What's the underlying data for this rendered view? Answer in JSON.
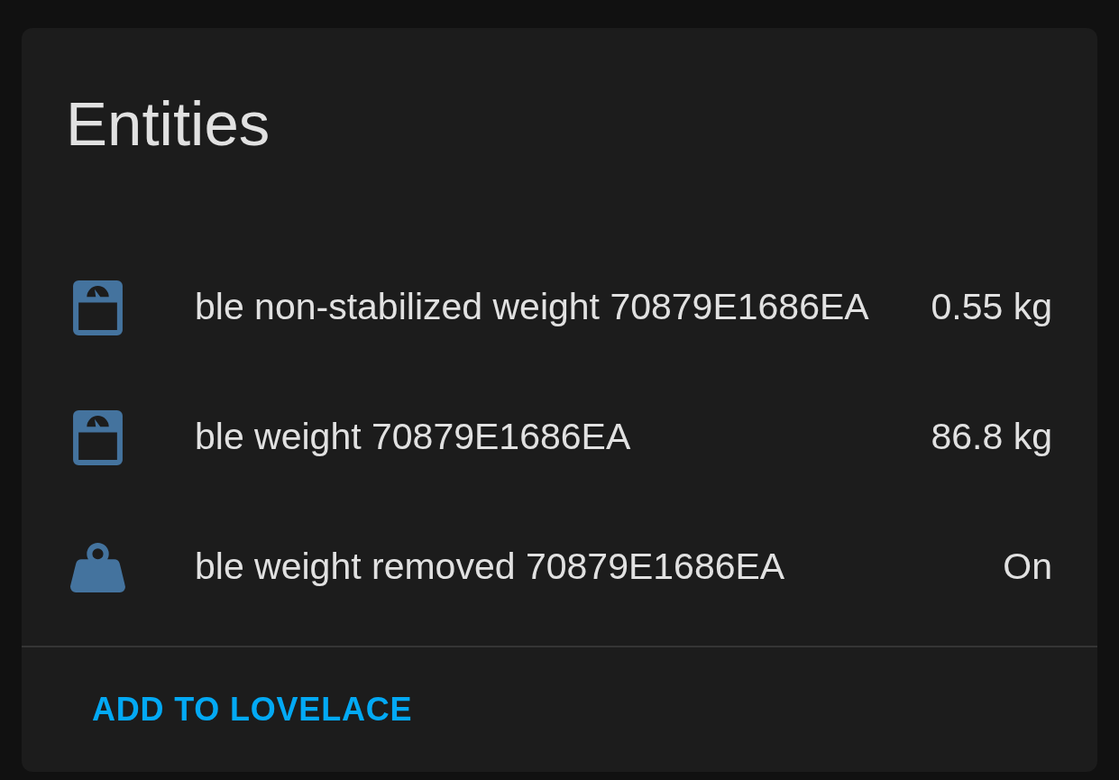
{
  "card": {
    "title": "Entities",
    "entities": [
      {
        "kind": "scale",
        "name": "ble non-stabilized weight 70879E1686EA",
        "state": "0.55 kg"
      },
      {
        "kind": "scale",
        "name": "ble weight 70879E1686EA",
        "state": "86.8 kg"
      },
      {
        "kind": "weight",
        "name": "ble weight removed 70879E1686EA",
        "state": "On"
      }
    ],
    "action": "ADD TO LOVELACE"
  }
}
